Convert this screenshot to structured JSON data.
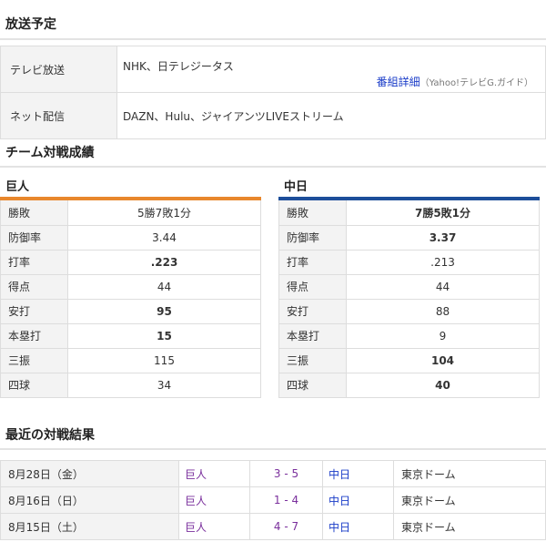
{
  "broadcast": {
    "title": "放送予定",
    "tv": {
      "label": "テレビ放送",
      "value": "NHK、日テレジータス",
      "detail_link": "番組詳細",
      "detail_source": "（Yahoo!テレビG.ガイド）"
    },
    "net": {
      "label": "ネット配信",
      "value": "DAZN、Hulu、ジャイアンツLIVEストリーム"
    }
  },
  "matchup": {
    "title": "チーム対戦成績",
    "colors": {
      "giants": "#e8872c",
      "dragons": "#1d4e9a"
    },
    "teams": [
      {
        "name": "巨人",
        "stats": [
          {
            "label": "勝敗",
            "value": "5勝7敗1分",
            "bold": false
          },
          {
            "label": "防御率",
            "value": "3.44",
            "bold": false
          },
          {
            "label": "打率",
            "value": ".223",
            "bold": true
          },
          {
            "label": "得点",
            "value": "44",
            "bold": false
          },
          {
            "label": "安打",
            "value": "95",
            "bold": true
          },
          {
            "label": "本塁打",
            "value": "15",
            "bold": true
          },
          {
            "label": "三振",
            "value": "115",
            "bold": false
          },
          {
            "label": "四球",
            "value": "34",
            "bold": false
          }
        ]
      },
      {
        "name": "中日",
        "stats": [
          {
            "label": "勝敗",
            "value": "7勝5敗1分",
            "bold": true
          },
          {
            "label": "防御率",
            "value": "3.37",
            "bold": true
          },
          {
            "label": "打率",
            "value": ".213",
            "bold": false
          },
          {
            "label": "得点",
            "value": "44",
            "bold": false
          },
          {
            "label": "安打",
            "value": "88",
            "bold": false
          },
          {
            "label": "本塁打",
            "value": "9",
            "bold": false
          },
          {
            "label": "三振",
            "value": "104",
            "bold": true
          },
          {
            "label": "四球",
            "value": "40",
            "bold": true
          }
        ]
      }
    ]
  },
  "results": {
    "title": "最近の対戦結果",
    "rows": [
      {
        "date": "8月28日（金）",
        "home": "巨人",
        "score": "3 - 5",
        "away": "中日",
        "venue": "東京ドーム"
      },
      {
        "date": "8月16日（日）",
        "home": "巨人",
        "score": "1 - 4",
        "away": "中日",
        "venue": "東京ドーム"
      },
      {
        "date": "8月15日（土）",
        "home": "巨人",
        "score": "4 - 7",
        "away": "中日",
        "venue": "東京ドーム"
      }
    ]
  }
}
